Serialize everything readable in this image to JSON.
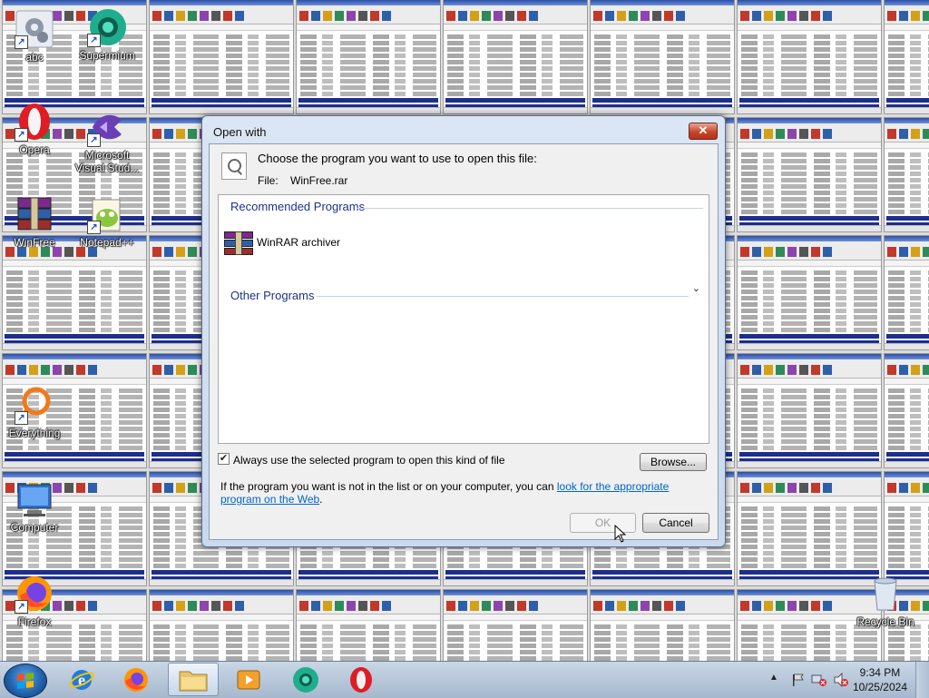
{
  "dialog": {
    "title": "Open with",
    "close_label": "✕",
    "instruction": "Choose the program you want to use to open this file:",
    "file_label": "File:",
    "file_name": "WinFree.rar",
    "recommended_header": "Recommended Programs",
    "recommended_programs": [
      "WinRAR archiver"
    ],
    "other_header": "Other Programs",
    "always_use_label": "Always use the selected program to open this kind of file",
    "always_use_checked": true,
    "browse_label": "Browse...",
    "info_text_before": "If the program you want is not in the list or on your computer, you can ",
    "info_link": "look for the appropriate program on the Web",
    "info_text_after": ".",
    "ok_label": "OK",
    "ok_enabled": false,
    "cancel_label": "Cancel"
  },
  "desktop_icons": [
    {
      "label": "abc",
      "icon": "settings-gear-icon"
    },
    {
      "label": "Supermium",
      "icon": "supermium-icon"
    },
    {
      "label": "Opera",
      "icon": "opera-icon"
    },
    {
      "label": "Microsoft Visual Stud...",
      "icon": "visual-studio-icon"
    },
    {
      "label": "WinFree",
      "icon": "winrar-icon"
    },
    {
      "label": "Notepad++",
      "icon": "notepad-plus-plus-icon"
    },
    {
      "label": "Everything",
      "icon": "everything-search-icon"
    },
    {
      "label": "Computer",
      "icon": "computer-icon"
    },
    {
      "label": "Firefox",
      "icon": "firefox-icon"
    },
    {
      "label": "Recycle Bin",
      "icon": "recycle-bin-icon"
    }
  ],
  "taskbar": {
    "apps": [
      "Internet Explorer",
      "Firefox",
      "File Explorer",
      "Media Player",
      "Supermium",
      "Opera"
    ],
    "time": "9:34 PM",
    "date": "10/25/2024"
  },
  "colors": {
    "link": "#0066cc",
    "group_header": "#1e3287",
    "close_button": "#c7452a"
  }
}
